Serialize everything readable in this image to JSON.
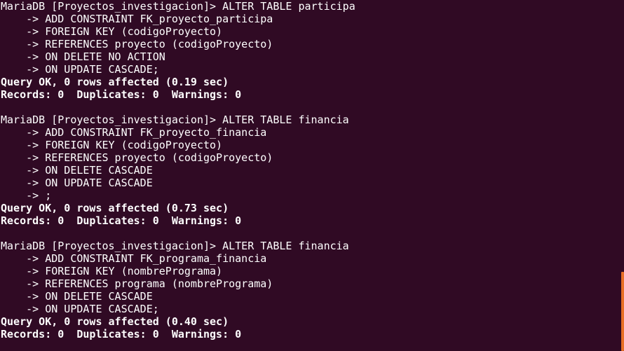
{
  "terminal": {
    "blocks": [
      {
        "lines": [
          "MariaDB [Proyectos_investigacion]> ALTER TABLE participa",
          "    -> ADD CONSTRAINT FK_proyecto_participa",
          "    -> FOREIGN KEY (codigoProyecto)",
          "    -> REFERENCES proyecto (codigoProyecto)",
          "    -> ON DELETE NO ACTION",
          "    -> ON UPDATE CASCADE;"
        ],
        "result": "Query OK, 0 rows affected (0.19 sec)",
        "records": "Records: 0  Duplicates: 0  Warnings: 0"
      },
      {
        "lines": [
          "MariaDB [Proyectos_investigacion]> ALTER TABLE financia",
          "    -> ADD CONSTRAINT FK_proyecto_financia",
          "    -> FOREIGN KEY (codigoProyecto)",
          "    -> REFERENCES proyecto (codigoProyecto)",
          "    -> ON DELETE CASCADE",
          "    -> ON UPDATE CASCADE",
          "    -> ;"
        ],
        "result": "Query OK, 0 rows affected (0.73 sec)",
        "records": "Records: 0  Duplicates: 0  Warnings: 0"
      },
      {
        "lines": [
          "MariaDB [Proyectos_investigacion]> ALTER TABLE financia",
          "    -> ADD CONSTRAINT FK_programa_financia",
          "    -> FOREIGN KEY (nombrePrograma)",
          "    -> REFERENCES programa (nombrePrograma)",
          "    -> ON DELETE CASCADE",
          "    -> ON UPDATE CASCADE;"
        ],
        "result": "Query OK, 0 rows affected (0.40 sec)",
        "records": "Records: 0  Duplicates: 0  Warnings: 0"
      }
    ]
  },
  "colors": {
    "background": "#300a24",
    "text": "#ffffff",
    "scrollbar": "#e76f26"
  }
}
